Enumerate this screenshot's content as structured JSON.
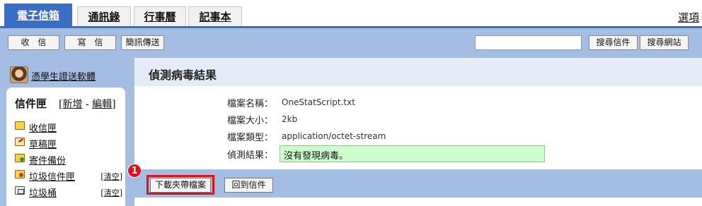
{
  "tabs": [
    {
      "label": "電子信箱",
      "active": true
    },
    {
      "label": "通訊錄",
      "active": false
    },
    {
      "label": "行事曆",
      "active": false
    },
    {
      "label": "記事本",
      "active": false
    }
  ],
  "options_label": "選項",
  "toolbar": {
    "receive_label": "收信",
    "compose_label": "寫信",
    "sms_label": "簡訊傳送",
    "search_value": "",
    "search_mail_label": "搜尋信件",
    "search_web_label": "搜尋網站"
  },
  "sidebar": {
    "user_name": "憑學生證送軟體",
    "folders_title": "信件匣",
    "new_label": "新增",
    "edit_label": "編輯",
    "folders": [
      {
        "label": "收信匣",
        "icon": "inbox-folder-icon",
        "clear": ""
      },
      {
        "label": "草稿匣",
        "icon": "drafts-folder-icon",
        "clear": ""
      },
      {
        "label": "寄件備份",
        "icon": "sent-folder-icon",
        "clear": ""
      },
      {
        "label": "垃圾信件匣",
        "icon": "spam-folder-icon",
        "clear": "清空"
      },
      {
        "label": "垃圾桶",
        "icon": "trash-folder-icon",
        "clear": "清空"
      }
    ]
  },
  "content": {
    "title": "偵測病毒結果",
    "rows": [
      {
        "label": "檔案名稱：",
        "value": "OneStatScript.txt"
      },
      {
        "label": "檔案大小：",
        "value": "2kb"
      },
      {
        "label": "檔案類型：",
        "value": "application/octet-stream"
      },
      {
        "label": "偵測結果：",
        "value": "沒有發現病毒。"
      }
    ],
    "result_color": "#ccffcc"
  },
  "actions": {
    "download_label": "下載夾帶檔案",
    "back_label": "回到信件",
    "step_number": "1",
    "highlight_color": "#e0101c"
  },
  "colors": {
    "accent": "#3a6dc5",
    "toolbar_bg": "#a4bde3"
  }
}
